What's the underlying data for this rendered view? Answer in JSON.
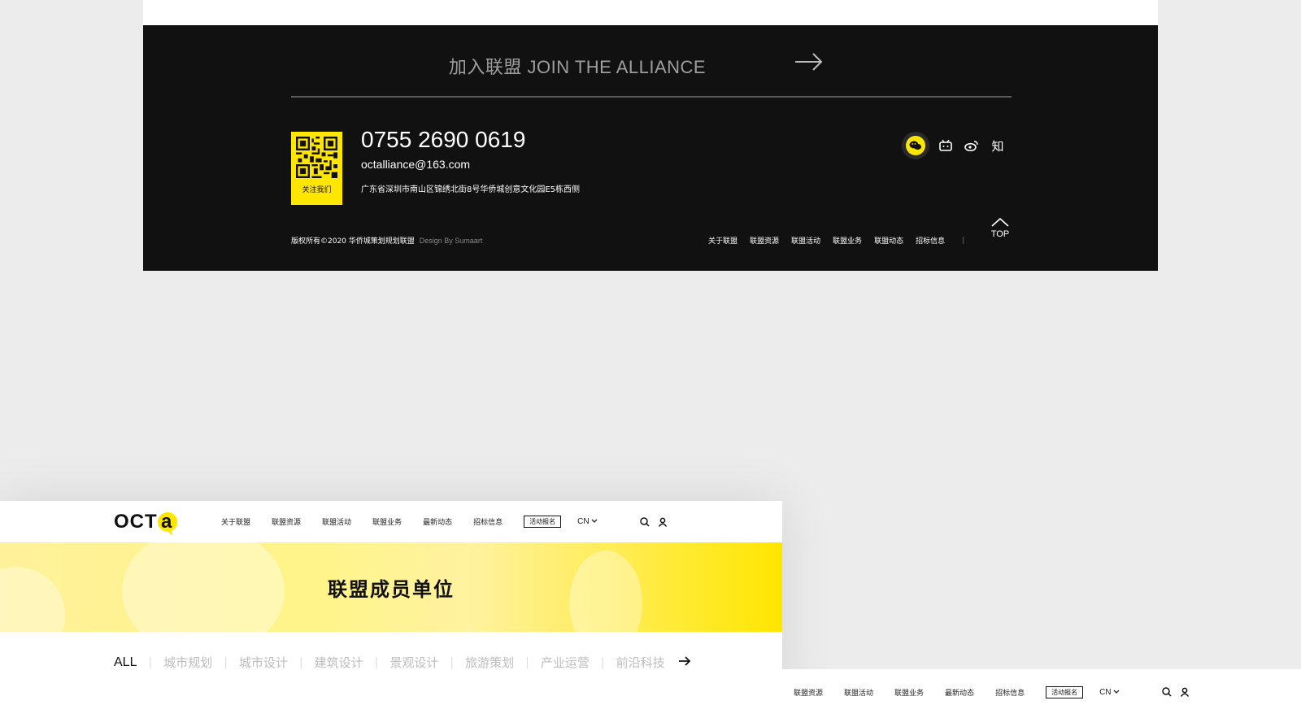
{
  "footer": {
    "join_label": "加入联盟  JOIN THE ALLIANCE",
    "qr_label": "关注我们",
    "phone": "0755 2690 0619",
    "email": "octalliance@163.com",
    "address": "广东省深圳市南山区锦绣北街8号华侨城创意文化园E5栋西侧",
    "copyright": "版权所有©2020 华侨城策划规划联盟",
    "design_credit": "Design By Sumaart",
    "nav": [
      "关于联盟",
      "联盟资源",
      "联盟活动",
      "联盟业务",
      "联盟动态",
      "招标信息"
    ],
    "separator": "|",
    "top_label": "TOP",
    "social": [
      "wechat-icon",
      "bilibili-icon",
      "weibo-icon",
      "zhihu-icon"
    ],
    "zhihu_glyph": "知",
    "accent": "#ffe600",
    "background": "#111111"
  },
  "site": {
    "logo": "OCT",
    "logo_accent": "a",
    "nav": [
      "关于联盟",
      "联盟资源",
      "联盟活动",
      "联盟业务",
      "最新动态",
      "招标信息"
    ],
    "cta": "活动报名",
    "lang": "CN",
    "banner_title": "联盟成员单位",
    "filter_all": "ALL",
    "filters": [
      "城市规划",
      "城市设计",
      "建筑设计",
      "景观设计",
      "旅游策划",
      "产业运营",
      "前沿科技"
    ]
  },
  "site2": {
    "nav": [
      "联盟资源",
      "联盟活动",
      "联盟业务",
      "最新动态",
      "招标信息"
    ],
    "cta": "活动报名",
    "lang": "CN"
  }
}
